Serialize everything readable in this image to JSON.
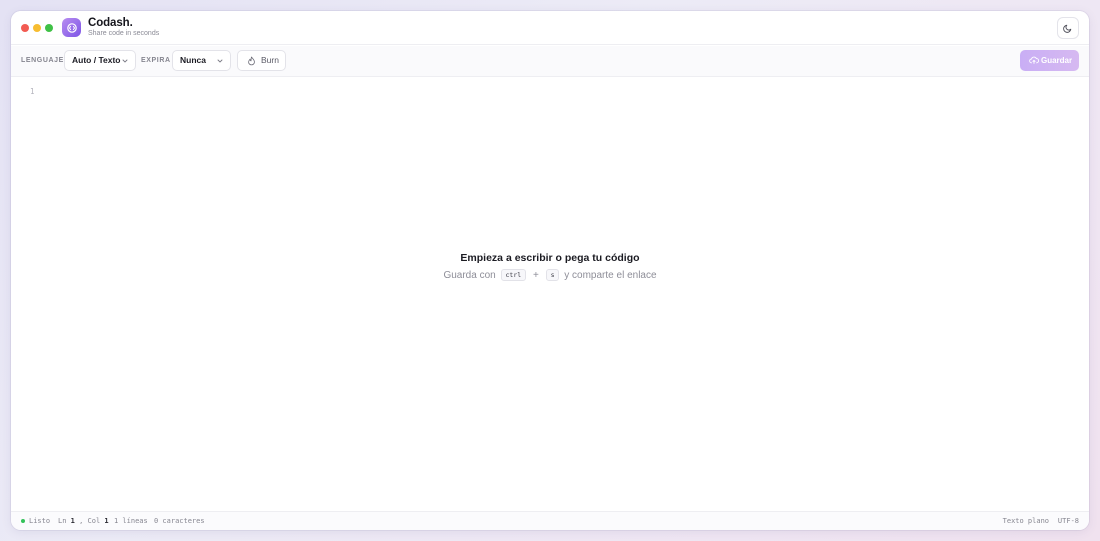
{
  "app": {
    "name": "Codash.",
    "tagline": "Share code in seconds"
  },
  "toolbar": {
    "language_label": "LENGUAJE",
    "language_value": "Auto / Texto",
    "expire_label": "EXPIRA",
    "expire_value": "Nunca",
    "burn_label": "Burn",
    "save_label": "Guardar"
  },
  "editor": {
    "line_number": "1",
    "empty_title": "Empieza a escribir o pega tu código",
    "empty_sub_prefix": "Guarda con",
    "key_ctrl": "ctrl",
    "key_plus": "+",
    "key_s": "s",
    "empty_sub_suffix": "y comparte el enlace"
  },
  "status": {
    "state": "Listo",
    "ln_label": "Ln",
    "ln_value": "1",
    "sep": ",",
    "col_label": "Col",
    "col_value": "1",
    "lines": "1 líneas",
    "chars": "0 caracteres",
    "mode": "Texto plano",
    "encoding": "UTF-8"
  },
  "colors": {
    "accent": "#8b5cf6",
    "save_button": "#c9aef5",
    "status_ok": "#34c25a"
  },
  "icons": [
    "logo-icon",
    "moon-icon",
    "chevron-down-icon",
    "flame-icon",
    "cloud-upload-icon"
  ]
}
